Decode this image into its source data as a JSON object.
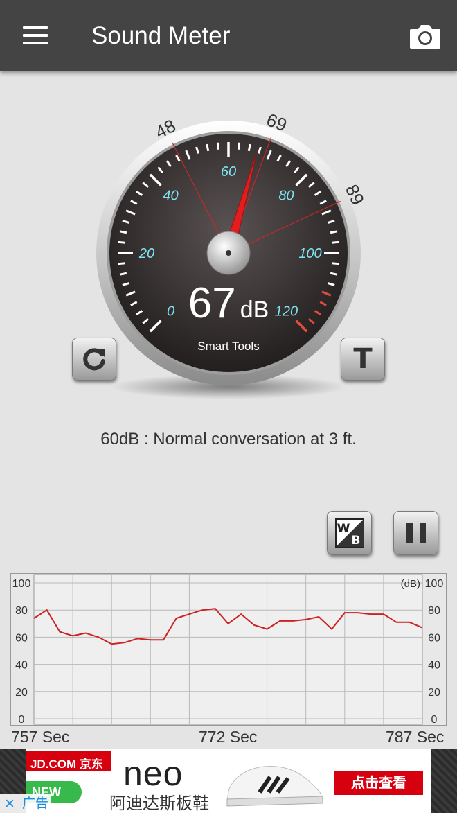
{
  "appbar": {
    "title": "Sound Meter"
  },
  "gauge": {
    "value": 67,
    "unit": "dB",
    "brand": "Smart Tools",
    "scale_labels": [
      "0",
      "20",
      "40",
      "60",
      "80",
      "100",
      "120"
    ],
    "marker_labels": [
      "48",
      "69",
      "89"
    ]
  },
  "info": {
    "text": "60dB : Normal conversation at 3 ft."
  },
  "chart": {
    "unit_label": "(dB)",
    "y_tick_labels": [
      "100",
      "80",
      "60",
      "40",
      "20",
      "0"
    ],
    "time_labels": [
      "757 Sec",
      "772 Sec",
      "787 Sec"
    ]
  },
  "chart_data": {
    "type": "line",
    "ylabel": "(dB)",
    "ylim": [
      0,
      100
    ],
    "x": [
      757,
      758,
      759,
      760,
      761,
      762,
      763,
      764,
      765,
      766,
      767,
      768,
      769,
      770,
      771,
      772,
      773,
      774,
      775,
      776,
      777,
      778,
      779,
      780,
      781,
      782,
      783,
      784,
      785,
      786,
      787
    ],
    "x_tick_labels": [
      "757 Sec",
      "772 Sec",
      "787 Sec"
    ],
    "series": [
      {
        "values": [
          74,
          80,
          64,
          61,
          63,
          60,
          55,
          56,
          59,
          58,
          58,
          74,
          77,
          80,
          81,
          70,
          77,
          69,
          66,
          72,
          72,
          73,
          75,
          66,
          78,
          78,
          77,
          77,
          71,
          71,
          67
        ]
      }
    ],
    "grid": true,
    "colors": {
      "line": "#cc2222"
    }
  },
  "ad": {
    "jd_label": "JD.COM 京东",
    "new_label": "NEW",
    "brand": "neo",
    "subtitle": "阿迪达斯板鞋",
    "cta": "点击查看",
    "tag": "广告",
    "close": "×"
  }
}
